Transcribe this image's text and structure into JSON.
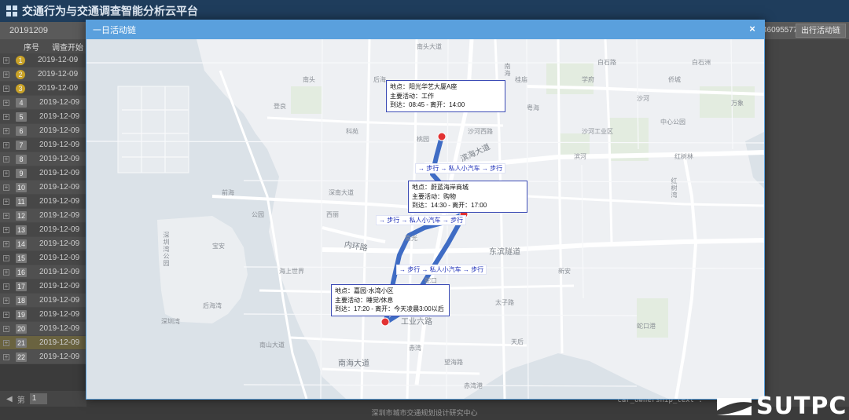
{
  "app": {
    "title": "交通行为与交通调查智能分析云平台",
    "toolbar_date": "20191209",
    "toolbar_right": "46095577",
    "export_label": "出行活动链"
  },
  "table": {
    "headers": [
      "序号",
      "调查开始"
    ],
    "rows": [
      {
        "num": "1",
        "date": "2019-12-09",
        "style": "gold"
      },
      {
        "num": "2",
        "date": "2019-12-09",
        "style": "gold"
      },
      {
        "num": "3",
        "date": "2019-12-09",
        "style": "gold"
      },
      {
        "num": "4",
        "date": "2019-12-09",
        "style": ""
      },
      {
        "num": "5",
        "date": "2019-12-09",
        "style": ""
      },
      {
        "num": "6",
        "date": "2019-12-09",
        "style": ""
      },
      {
        "num": "7",
        "date": "2019-12-09",
        "style": ""
      },
      {
        "num": "8",
        "date": "2019-12-09",
        "style": ""
      },
      {
        "num": "9",
        "date": "2019-12-09",
        "style": ""
      },
      {
        "num": "10",
        "date": "2019-12-09",
        "style": ""
      },
      {
        "num": "11",
        "date": "2019-12-09",
        "style": ""
      },
      {
        "num": "12",
        "date": "2019-12-09",
        "style": ""
      },
      {
        "num": "13",
        "date": "2019-12-09",
        "style": ""
      },
      {
        "num": "14",
        "date": "2019-12-09",
        "style": ""
      },
      {
        "num": "15",
        "date": "2019-12-09",
        "style": ""
      },
      {
        "num": "16",
        "date": "2019-12-09",
        "style": ""
      },
      {
        "num": "17",
        "date": "2019-12-09",
        "style": ""
      },
      {
        "num": "18",
        "date": "2019-12-09",
        "style": ""
      },
      {
        "num": "19",
        "date": "2019-12-09",
        "style": ""
      },
      {
        "num": "20",
        "date": "2019-12-09",
        "style": ""
      },
      {
        "num": "21",
        "date": "2019-12-09",
        "style": "hl"
      },
      {
        "num": "22",
        "date": "2019-12-09",
        "style": ""
      }
    ],
    "pager_label": "第",
    "pager_page": "1"
  },
  "footer": "深圳市城市交通规划设计研究中心",
  "code_snippet": "\"car_ownership_text\": \"\",",
  "modal": {
    "title": "一日活动链",
    "close_glyph": "×"
  },
  "map": {
    "labels": {
      "nanshan_ave": "南头大道",
      "nanshan_ave2": "南山大道",
      "nanhai": "南海",
      "nanhai_ave": "南海大道",
      "nantou": "南头",
      "shennan_rd": "深南大道",
      "binhai_ave": "滨海大道",
      "binhe": "滨河",
      "dongbin_tunnel": "东滨隧道",
      "neihuan_rd": "内环路",
      "keyuan": "科苑",
      "houhai": "后海",
      "shahe": "沙河",
      "shahe_west": "沙河西路",
      "wanxiang": "万象",
      "baishi_rd": "白石路",
      "baishizhou": "白石洲",
      "zhongxin_park": "中心公园",
      "shekou": "蛇口",
      "chiwan": "赤湾",
      "gongye_6th": "工业六路",
      "tianhou": "天后",
      "honglin_rd": "红树林",
      "wanghai_rd": "望海路",
      "shenzhen_bay": "深圳湾",
      "houhai_bay": "后海湾",
      "shenzhenwan_park": "深圳湾公园",
      "qianhai": "前海",
      "dengliang": "登良",
      "taoyuan": "桃园",
      "xili": "西丽",
      "baoan": "宝安",
      "park": "公园",
      "haishang": "海上世界",
      "nanguang": "南光",
      "xuefu": "学府",
      "guimiao": "桂庙",
      "shekou_port": "蛇口港",
      "taizi_rd": "太子路",
      "chiwan_port": "赤湾港",
      "xinan": "新安",
      "hongshuwan": "红树湾",
      "yuehai": "粤海",
      "qiaocheng": "侨城",
      "shahe_ind": "沙河工业区"
    },
    "stops": [
      {
        "place": "地点：阳光华艺大厦A座",
        "activity": "主要活动：工作",
        "time": "到达：08:45 - 离开：14:00"
      },
      {
        "place": "地点：蔚蓝海岸商城",
        "activity": "主要活动：购物",
        "time": "到达：14:30 - 离开：17:00"
      },
      {
        "place": "地点：嘉园·水湾小区",
        "activity": "主要活动：睡觉/休息",
        "time": "到达：17:20 - 离开：今天凌晨3:00以后"
      }
    ],
    "modes": [
      "→ 步行 → 私人小汽车 → 步行",
      "→ 步行 → 私人小汽车 → 步行",
      "→ 步行 → 私人小汽车 → 步行"
    ],
    "colors": {
      "route": "#3f6cc4",
      "stop": "#e23333",
      "water": "#dbe2e8",
      "land": "#eef0f3",
      "green": "#e3ece0"
    }
  },
  "logo": {
    "text": "SUTPC"
  }
}
